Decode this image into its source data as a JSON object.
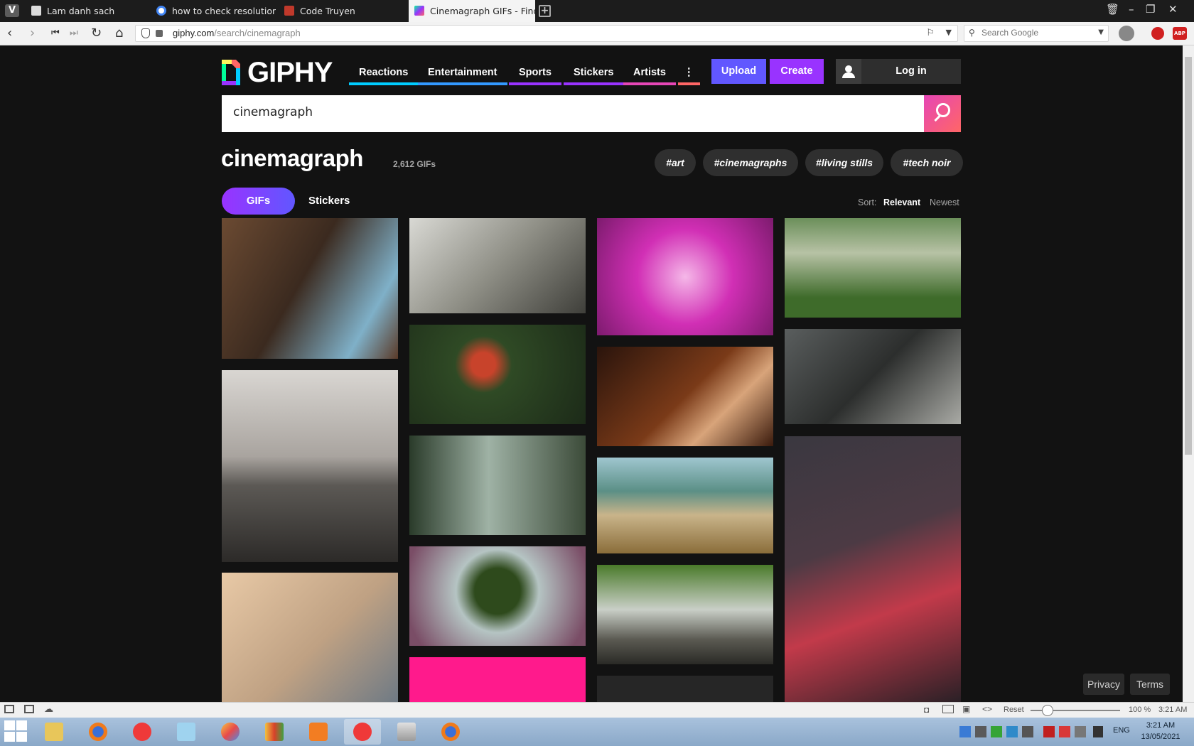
{
  "browser": {
    "tabs": [
      {
        "title": "Lam danh sach",
        "favicon_color": "#dcdcdc"
      },
      {
        "title": "how to check resolution siz",
        "favicon_color": "#4285f4"
      },
      {
        "title": "Code Truyen",
        "favicon_color": "#c0392b"
      },
      {
        "title": "Cinemagraph GIFs - Find &",
        "favicon_color": "#8a2be2"
      }
    ],
    "url_host": "giphy.com",
    "url_path": "/search/cinemagraph",
    "search_placeholder": "Search Google",
    "status": {
      "reset": "Reset",
      "zoom": "100 %",
      "time": "3:21 AM"
    }
  },
  "giphy": {
    "logo": "GIPHY",
    "nav": [
      {
        "label": "Reactions",
        "color": "#00ccff"
      },
      {
        "label": "Entertainment",
        "color": "#3399ff"
      },
      {
        "label": "Sports",
        "color": "#9933ff"
      },
      {
        "label": "Stickers",
        "color": "#9933ff"
      },
      {
        "label": "Artists",
        "color": "#e646b6"
      },
      {
        "label": "⋮",
        "color": "#ff6666"
      }
    ],
    "upload": "Upload",
    "create": "Create",
    "login": "Log in",
    "query": "cinemagraph",
    "heading": "cinemagraph",
    "count": "2,612 GIFs",
    "tags": [
      "#art",
      "#cinemagraphs",
      "#living stills",
      "#tech noir"
    ],
    "type_tabs": {
      "gifs": "GIFs",
      "stickers": "Stickers"
    },
    "sort": {
      "label": "Sort:",
      "relevant": "Relevant",
      "newest": "Newest"
    },
    "footer": {
      "privacy": "Privacy",
      "terms": "Terms"
    }
  },
  "taskbar": {
    "clock_time": "3:21 AM",
    "clock_date": "13/05/2021",
    "lang": "ENG"
  }
}
